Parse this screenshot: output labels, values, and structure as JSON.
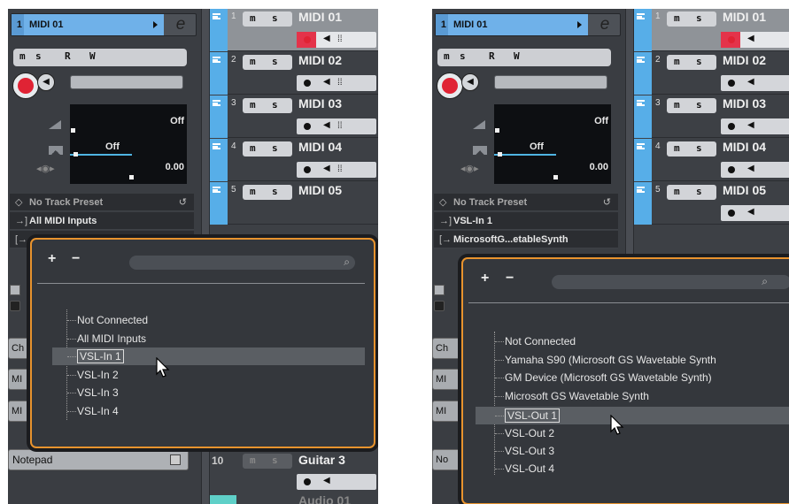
{
  "left": {
    "inspector": {
      "track_number": "1",
      "track_name": "MIDI 01",
      "buttons": [
        "m",
        "s",
        "R",
        "W"
      ],
      "param_values": [
        "Off",
        "Off",
        "0.00"
      ],
      "preset": "No Track Preset",
      "input_routing": "All MIDI Inputs",
      "tabs": [
        "Ch",
        "MI",
        "MI"
      ],
      "notepad": "Notepad"
    },
    "tracks": [
      {
        "number": "1",
        "name": "MIDI 01",
        "selected": true
      },
      {
        "number": "2",
        "name": "MIDI 02"
      },
      {
        "number": "3",
        "name": "MIDI 03"
      },
      {
        "number": "4",
        "name": "MIDI 04"
      },
      {
        "number": "5",
        "name": "MIDI 05"
      }
    ],
    "bottom_track": {
      "number": "10",
      "name": "Guitar 3",
      "next_name": "Audio 01"
    },
    "popup": {
      "add": "+",
      "remove": "−",
      "options": [
        "Not Connected",
        "All MIDI Inputs",
        "VSL-In 1",
        "VSL-In 2",
        "VSL-In 3",
        "VSL-In 4"
      ],
      "selected": "VSL-In 1"
    }
  },
  "right": {
    "inspector": {
      "track_number": "1",
      "track_name": "MIDI 01",
      "buttons": [
        "m",
        "s",
        "R",
        "W"
      ],
      "param_values": [
        "Off",
        "Off",
        "0.00"
      ],
      "preset": "No Track Preset",
      "input_routing": "VSL-In 1",
      "output_routing": "MicrosoftG...etableSynth",
      "tabs": [
        "Ch",
        "MI",
        "MI",
        "No"
      ]
    },
    "tracks": [
      {
        "number": "1",
        "name": "MIDI 01",
        "selected": true
      },
      {
        "number": "2",
        "name": "MIDI 02"
      },
      {
        "number": "3",
        "name": "MIDI 03"
      },
      {
        "number": "4",
        "name": "MIDI 04"
      },
      {
        "number": "5",
        "name": "MIDI 05"
      }
    ],
    "popup": {
      "add": "+",
      "remove": "−",
      "options": [
        "Not Connected",
        "Yamaha S90 (Microsoft GS Wavetable Synth",
        "GM Device (Microsoft GS Wavetable Synth)",
        "Microsoft GS Wavetable Synth",
        "VSL-Out 1",
        "VSL-Out 2",
        "VSL-Out 3",
        "VSL-Out 4"
      ],
      "selected": "VSL-Out 1"
    }
  },
  "icons": {
    "search": "search-icon",
    "edit": "edit-icon",
    "record": "record-icon",
    "monitor": "monitor-icon",
    "cursor": "mouse-cursor-icon"
  },
  "colors": {
    "accent_blue": "#6fb1e9",
    "popup_border": "#e8932e",
    "record_red": "#e02334"
  }
}
